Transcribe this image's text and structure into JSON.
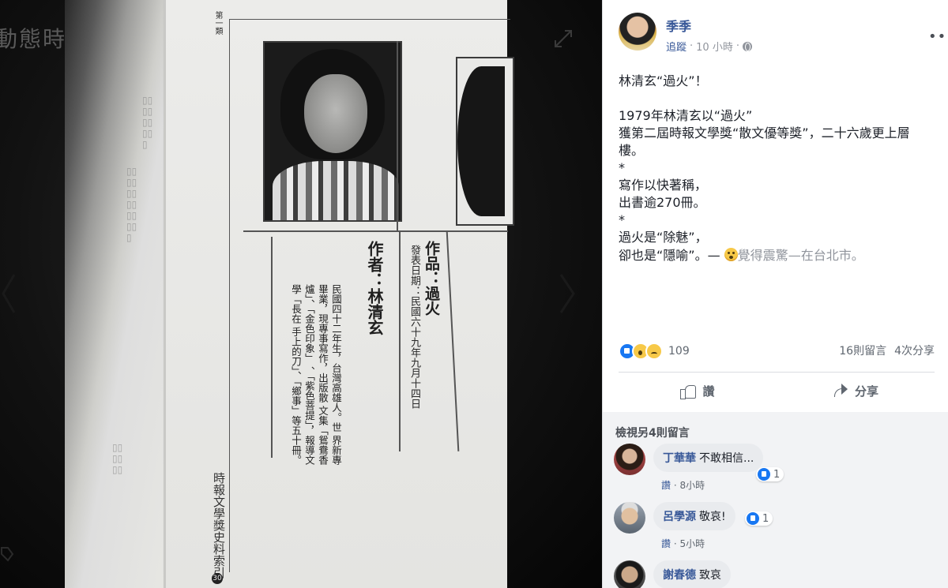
{
  "viewer": {
    "background_title": "動態時報相片",
    "photo": {
      "section_mark": "第一類",
      "work_heading": "作品：過火",
      "publication": "發表日期：民國六十九年九月十四日",
      "author_heading": "作者：林清玄",
      "bio_lines": [
        "民國四十二年生，台灣高雄人。世",
        "界新專畢業，現專事寫作，出版散",
        "文集「鴛鴦香爐」、「金色印象」",
        "、「紫色菩提」，報導文學「長在",
        "手上的刀」、「鄉事」等五十冊。"
      ],
      "footer_title": "時報文學獎史料索引",
      "page_number": "30"
    }
  },
  "post": {
    "author": "季季",
    "follow_label": "追蹤",
    "separator": "·",
    "time": "10 小時",
    "more_label": "•••",
    "body": {
      "title": "林清玄“過火”！",
      "line1": "1979年林清玄以“過火”",
      "line2": "獲第二屆時報文學獎“散文優等獎”，二十六歲更上層樓。",
      "star1": "*",
      "line3": "寫作以快著稱，",
      "line4": "出書逾270冊。",
      "star2": "*",
      "line5": "過火是“除魅”，",
      "line6_prefix": "卻也是“隱喻”。— ",
      "feeling": "覺得震驚",
      "feeling_sep": "—",
      "location": "在台北市",
      "line6_end": "。"
    },
    "stats": {
      "reaction_count": "109",
      "comments": "16則留言",
      "shares": "4次分享"
    },
    "actions": {
      "like": "讚",
      "share": "分享"
    }
  },
  "comments": {
    "view_more": "檢視另4則留言",
    "items": [
      {
        "name": "丁華華",
        "text": "不敢相信...",
        "like_label": "讚",
        "time": "8小時",
        "reactions": "1"
      },
      {
        "name": "呂學源",
        "text": "敬哀!",
        "like_label": "讚",
        "time": "5小時",
        "reactions": "1"
      },
      {
        "name": "謝春德",
        "text": "致哀"
      }
    ]
  },
  "colors": {
    "link": "#385898",
    "like_blue": "#1877f2",
    "muted": "#90949c"
  }
}
